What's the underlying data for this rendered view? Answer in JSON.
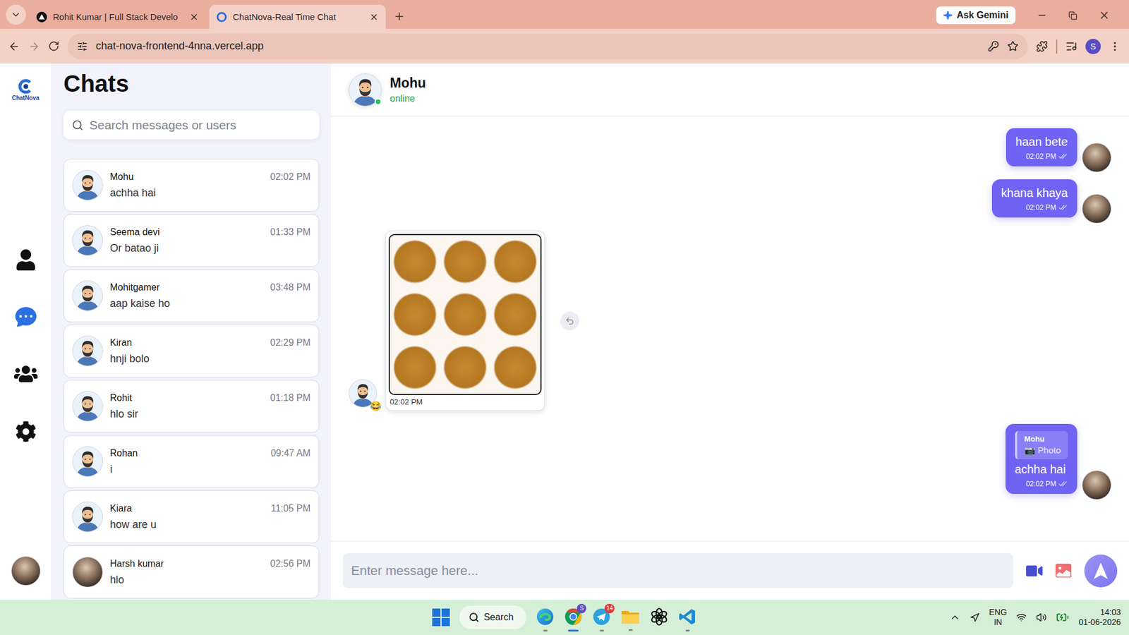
{
  "browser": {
    "tabs": [
      {
        "title": "Rohit Kumar | Full Stack Develo",
        "selected": false
      },
      {
        "title": "ChatNova-Real Time Chat",
        "selected": true
      }
    ],
    "ask": "Ask Gemini",
    "url": "chat-nova-frontend-4nna.vercel.app",
    "profile": "S"
  },
  "app": {
    "logo": "ChatNova",
    "nav": [
      {
        "selected": false
      },
      {
        "selected": true
      },
      {
        "selected": false
      },
      {
        "selected": false
      }
    ],
    "chats_title": "Chats",
    "search": {
      "placeholder": "Search messages or users"
    },
    "chats": [
      {
        "name": "Mohu",
        "message": "achha hai",
        "time": "02:02 PM",
        "kind": "cartoon"
      },
      {
        "name": "Seema devi",
        "message": "Or batao ji",
        "time": "01:33 PM",
        "kind": "cartoon"
      },
      {
        "name": "Mohitgamer",
        "message": "aap kaise ho",
        "time": "03:48 PM",
        "kind": "cartoon"
      },
      {
        "name": "Kiran",
        "message": "hnji bolo",
        "time": "02:29 PM",
        "kind": "cartoon"
      },
      {
        "name": "Rohit",
        "message": "hlo sir",
        "time": "01:18 PM",
        "kind": "cartoon"
      },
      {
        "name": "Rohan",
        "message": "i",
        "time": "09:47 AM",
        "kind": "cartoon"
      },
      {
        "name": "Kiara",
        "message": "how are u",
        "time": "11:05 PM",
        "kind": "cartoon"
      },
      {
        "name": "Harsh kumar",
        "message": "hlo",
        "time": "02:56 PM",
        "kind": "photo"
      }
    ],
    "conversation": {
      "name": "Mohu",
      "status": "online",
      "online": true,
      "messages": [
        {
          "kind": "text",
          "mine": true,
          "text": "haan bete",
          "time": "02:02 PM",
          "seen": true
        },
        {
          "kind": "text",
          "mine": true,
          "text": "khana khaya",
          "time": "02:02 PM",
          "seen": true
        },
        {
          "kind": "image",
          "mine": false,
          "time": "02:02 PM",
          "reaction": "😂"
        },
        {
          "kind": "reply",
          "mine": true,
          "quote_name": "Mohu",
          "quote_text": "📷 Photo",
          "text": "achha hai",
          "time": "02:02 PM",
          "seen": true
        }
      ]
    },
    "input": {
      "placeholder": "Enter message here..."
    }
  },
  "taskbar": {
    "search": "Search",
    "apps": [
      {
        "badge": "",
        "running": true,
        "selected": false
      },
      {
        "badge": "S",
        "running": true,
        "selected": true
      },
      {
        "badge": "14",
        "running": true,
        "selected": false
      },
      {
        "badge": "",
        "running": true,
        "selected": false
      },
      {
        "badge": "",
        "running": false,
        "selected": false
      },
      {
        "badge": "",
        "running": true,
        "selected": false
      }
    ],
    "tray": {
      "language": "ENG",
      "region": "IN",
      "time": "14:03",
      "date": "01-06-2026"
    }
  }
}
